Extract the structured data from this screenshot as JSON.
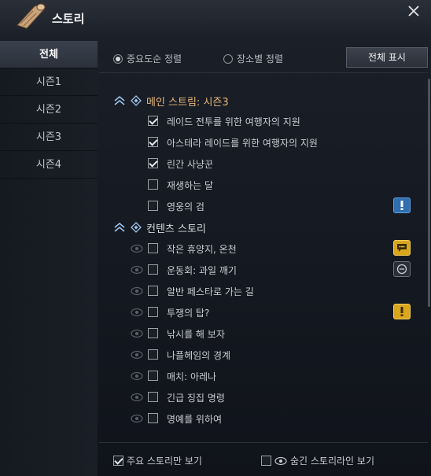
{
  "window": {
    "title": "스토리"
  },
  "sidebar": {
    "items": [
      {
        "label": "전체",
        "active": true
      },
      {
        "label": "시즌1"
      },
      {
        "label": "시즌2"
      },
      {
        "label": "시즌3"
      },
      {
        "label": "시즌4"
      }
    ]
  },
  "sort": {
    "by_importance": "중요도순 정렬",
    "by_location": "장소별 정렬",
    "selected": "by_importance"
  },
  "show_all_label": "전체 표시",
  "groups": {
    "main": {
      "title": "메인 스트림: 시즌3",
      "items": [
        {
          "label": "레이드 전투를 위한 여행자의 지원",
          "checked": true
        },
        {
          "label": "아스테라 레이드를 위한 여행자의 지원",
          "checked": true
        },
        {
          "label": "린간 사냥꾼",
          "checked": true
        },
        {
          "label": "재생하는 달",
          "checked": false
        },
        {
          "label": "영웅의 검",
          "checked": false,
          "badge": "exclamation-blue"
        }
      ]
    },
    "content": {
      "title": "컨텐츠 스토리",
      "items": [
        {
          "label": "작은 휴양지, 온천",
          "checked": false,
          "badge": "chat-yellow"
        },
        {
          "label": "운동회: 과일 깨기",
          "checked": false,
          "badge": "circle"
        },
        {
          "label": "알반 페스타로 가는 길",
          "checked": false
        },
        {
          "label": "투쟁의 탑?",
          "checked": false,
          "badge": "exclamation-yellow"
        },
        {
          "label": "낚시를 해 보자",
          "checked": false
        },
        {
          "label": "나플헤임의 경계",
          "checked": false
        },
        {
          "label": "매치: 아레나",
          "checked": false
        },
        {
          "label": "긴급 징집 명령",
          "checked": false
        },
        {
          "label": "명예를 위하여",
          "checked": false
        }
      ]
    }
  },
  "footer": {
    "main_only": {
      "label": "주요 스토리만 보기",
      "checked": true
    },
    "hidden_lines": {
      "label": "숨긴 스토리라인 보기",
      "checked": false
    }
  },
  "colors": {
    "main_group_title": "#e8b87a",
    "blue_badge": "#2f6fb0",
    "yellow_badge": "#d9a61c"
  }
}
